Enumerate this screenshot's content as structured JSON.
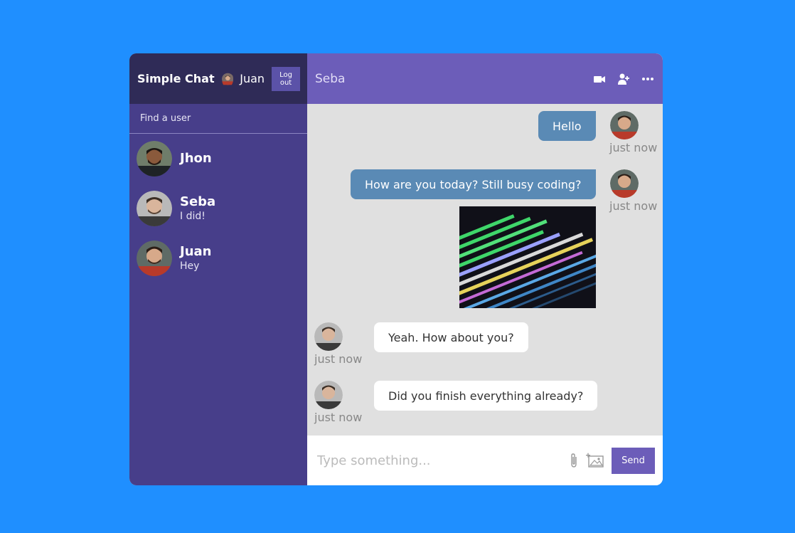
{
  "sidebar": {
    "brand": "Simple Chat",
    "current_user": "Juan",
    "logout_label": "Log out",
    "search_placeholder": "Find a user",
    "users": [
      {
        "name": "Jhon",
        "last": ""
      },
      {
        "name": "Seba",
        "last": "I did!"
      },
      {
        "name": "Juan",
        "last": "Hey"
      }
    ]
  },
  "chat": {
    "title": "Seba",
    "header_icons": [
      "video-icon",
      "add-user-icon",
      "more-icon"
    ],
    "messages": [
      {
        "text": "Hello",
        "time": "just now",
        "direction": "out"
      },
      {
        "text": "How are you today? Still busy coding?",
        "time": "just now",
        "direction": "out",
        "has_image": true
      },
      {
        "text": "Yeah. How about you?",
        "time": "just now",
        "direction": "in"
      },
      {
        "text": "Did you finish everything already?",
        "time": "just now",
        "direction": "in"
      }
    ],
    "input_placeholder": "Type something...",
    "send_label": "Send"
  },
  "colors": {
    "background": "#1f8fff",
    "sidebar": "#473e8a",
    "sidebar_header": "#2f2b57",
    "chat_header": "#6c5db9",
    "outgoing_bubble": "#5a8ab5",
    "incoming_bubble": "#ffffff"
  }
}
